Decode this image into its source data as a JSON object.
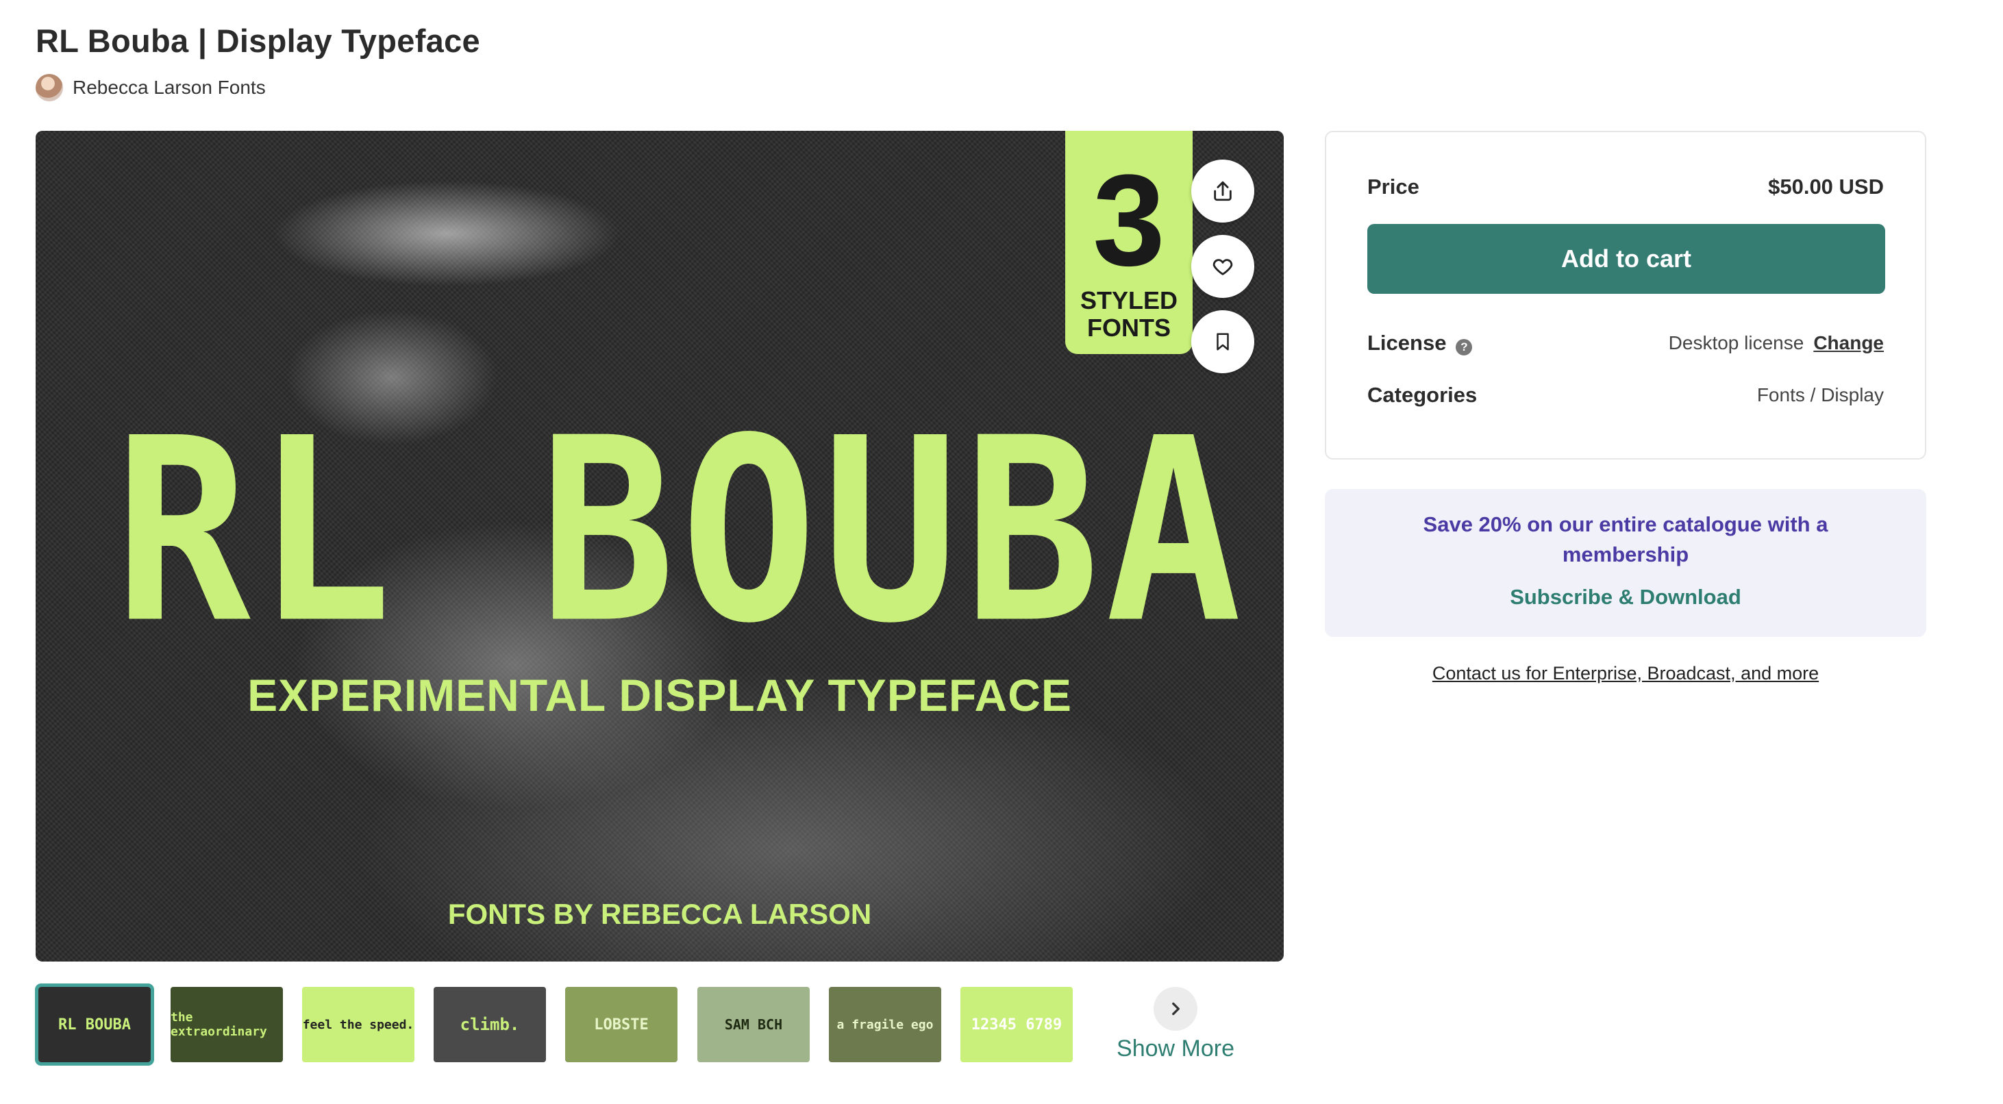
{
  "product": {
    "title": "RL Bouba | Display Typeface",
    "author": "Rebecca Larson Fonts"
  },
  "hero": {
    "badge_number": "3",
    "badge_text": "STYLED FONTS",
    "title": "RL BOUBA",
    "subtitle": "EXPERIMENTAL DISPLAY TYPEFACE",
    "credit": "FONTS BY REBECCA LARSON",
    "actions": [
      "share-icon",
      "heart-icon",
      "bookmark-icon"
    ]
  },
  "thumbnails": {
    "items": [
      {
        "text": "RL BOUBA",
        "bg": "#2e2e2e"
      },
      {
        "text": "the extraordinary",
        "bg": "#3f4f2a"
      },
      {
        "text": "feel the speed.",
        "bg": "#c9f07a"
      },
      {
        "text": "climb.",
        "bg": "#4a4a4a"
      },
      {
        "text": "LOBSTE",
        "bg": "#8aa05a"
      },
      {
        "text": "SAM BCH",
        "bg": "#9fb48a"
      },
      {
        "text": "a fragile ego",
        "bg": "#6c7a4e"
      },
      {
        "text": "12345 6789",
        "bg": "#c9f07a"
      }
    ],
    "show_more": "Show More"
  },
  "purchase": {
    "price_label": "Price",
    "price_value": "$50.00 USD",
    "add_to_cart": "Add to cart",
    "license_label": "License",
    "license_value": "Desktop license",
    "license_change": "Change",
    "categories_label": "Categories",
    "categories_value": "Fonts / Display"
  },
  "promo": {
    "text": "Save 20% on our entire catalogue with a membership",
    "link": "Subscribe & Download"
  },
  "contact": "Contact us for Enterprise, Broadcast, and more",
  "colors": {
    "accent_green": "#c9f07a",
    "button_teal": "#357c73",
    "link_teal": "#2d7d70",
    "promo_purple": "#4b3aa3"
  }
}
